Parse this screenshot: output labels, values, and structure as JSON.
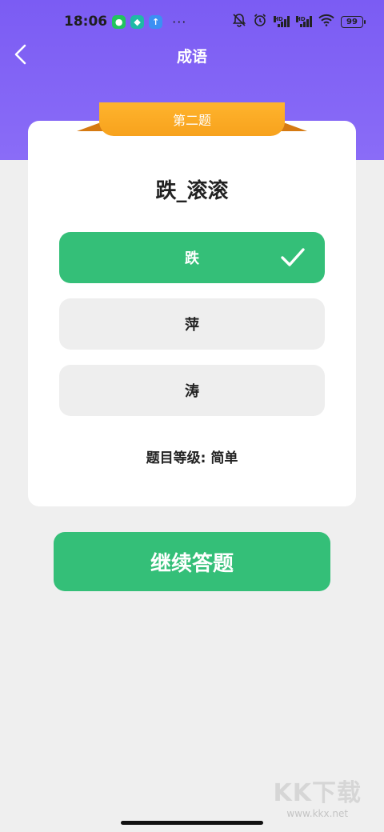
{
  "status_bar": {
    "time": "18:06",
    "more": "···",
    "battery": "99"
  },
  "nav": {
    "title": "成语"
  },
  "ribbon": {
    "label": "第二题"
  },
  "question": {
    "text": "跌_滚滚"
  },
  "options": [
    {
      "label": "跌",
      "state": "correct"
    },
    {
      "label": "萍",
      "state": "normal"
    },
    {
      "label": "涛",
      "state": "normal"
    }
  ],
  "level": {
    "text": "题目等级: 简单"
  },
  "continue": {
    "label": "继续答题"
  },
  "watermark": {
    "logo": "KK下载",
    "url": "www.kkx.net"
  },
  "colors": {
    "header": "#7b5cf3",
    "accent_green": "#34bf78",
    "ribbon": "#f7a21d"
  }
}
